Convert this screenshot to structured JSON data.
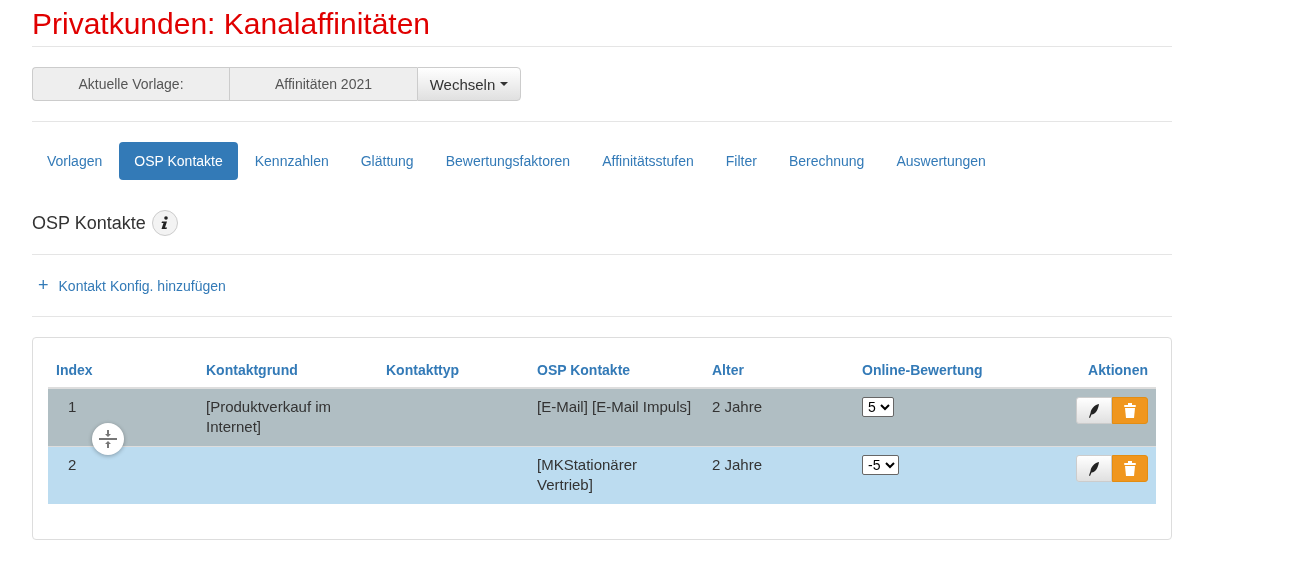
{
  "page_title": "Privatkunden: Kanalaffinitäten",
  "template_bar": {
    "label": "Aktuelle Vorlage:",
    "value": "Affinitäten 2021",
    "button": "Wechseln"
  },
  "tabs": [
    {
      "label": "Vorlagen",
      "selected": false
    },
    {
      "label": "OSP Kontakte",
      "selected": true
    },
    {
      "label": "Kennzahlen",
      "selected": false
    },
    {
      "label": "Glättung",
      "selected": false
    },
    {
      "label": "Bewertungsfaktoren",
      "selected": false
    },
    {
      "label": "Affinitätsstufen",
      "selected": false
    },
    {
      "label": "Filter",
      "selected": false
    },
    {
      "label": "Berechnung",
      "selected": false
    },
    {
      "label": "Auswertungen",
      "selected": false
    }
  ],
  "section_title": "OSP Kontakte",
  "add_link": {
    "icon": "+",
    "label": "Kontakt Konfig. hinzufügen"
  },
  "table": {
    "columns": [
      "Index",
      "Kontaktgrund",
      "Kontakttyp",
      "OSP Kontakte",
      "Alter",
      "Online-Bewertung",
      "Aktionen"
    ],
    "rows": [
      {
        "index": "1",
        "kontaktgrund": "[Produktverkauf im Internet]",
        "osp_kontakte": "[E-Mail] [E-Mail Impuls]",
        "alter": "2 Jahre",
        "online_bewertung": "5",
        "dragging": true,
        "selected": false
      },
      {
        "index": "2",
        "kontaktgrund": "",
        "osp_kontakte": "[MKStationärer Vertrieb]",
        "alter": "2 Jahre",
        "online_bewertung": "-5",
        "dragging": false,
        "selected": true
      }
    ]
  }
}
